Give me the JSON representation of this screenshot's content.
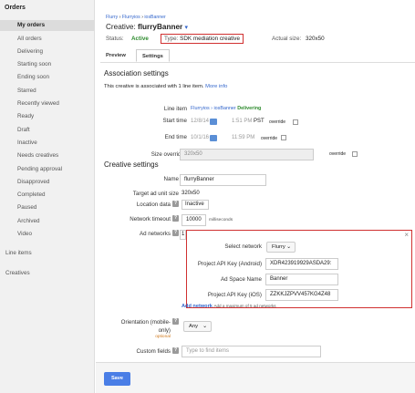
{
  "sidebar": {
    "heading": "Orders",
    "items": [
      {
        "label": "My orders",
        "active": true
      },
      {
        "label": "All orders"
      },
      {
        "label": "Delivering"
      },
      {
        "label": "Starting soon"
      },
      {
        "label": "Ending soon"
      },
      {
        "label": "Starred"
      },
      {
        "label": "Recently viewed"
      },
      {
        "label": "Ready"
      },
      {
        "label": "Draft"
      },
      {
        "label": "Inactive"
      },
      {
        "label": "Needs creatives"
      },
      {
        "label": "Pending approval"
      },
      {
        "label": "Disapproved"
      },
      {
        "label": "Completed"
      },
      {
        "label": "Paused"
      },
      {
        "label": "Archived"
      },
      {
        "label": "Video"
      }
    ],
    "line_items": "Line items",
    "creatives": "Creatives"
  },
  "breadcrumb": {
    "a": "Flurry",
    "b": "Flurryios",
    "c": "iosBanner",
    "sep": " › "
  },
  "title": {
    "prefix": "Creative: ",
    "name": "flurryBanner",
    "caret": "▾"
  },
  "status": {
    "label": "Status:",
    "value": "Active",
    "type_label": "Type:",
    "type_value": "SDK mediation creative",
    "size_label": "Actual size:",
    "size_value": "320x50"
  },
  "tabs": {
    "preview": "Preview",
    "settings": "Settings"
  },
  "association": {
    "heading": "Association settings",
    "text": "This creative is associated with 1 line item.",
    "more_info": "More info",
    "line_item_label": "Line item",
    "line_item_value": "Flurryios › iosBanner",
    "line_item_status": "Delivering",
    "start_label": "Start time",
    "start_date": "12/8/14",
    "start_time": "1:51 PM",
    "start_tz": "PST",
    "overrride": "override",
    "end_label": "End time",
    "end_date": "10/1/16",
    "end_time": "11:59 PM",
    "size_override_label": "Size overrides",
    "size_override_value": "320x50"
  },
  "creative": {
    "heading": "Creative settings",
    "name_label": "Name",
    "name_value": "flurryBanner",
    "target_label": "Target ad unit size",
    "target_value": "320x50",
    "location_label": "Location data",
    "location_value": "Inactive",
    "timeout_label": "Network timeout",
    "timeout_value": "10000",
    "timeout_unit": "milliseconds",
    "ad_networks_label": "Ad networks",
    "ad_networks_count": "1",
    "popup": {
      "select_label": "Select network",
      "select_value": "Flurry",
      "api_android_label": "Project API Key (Android)",
      "api_android_value": "XDR423919929ASDA29:",
      "space_label": "Ad Space Name",
      "space_value": "Banner",
      "api_ios_label": "Project API Key (iOS)",
      "api_ios_value": "ZZKKJZPVV457KG4Z48",
      "close": "×"
    },
    "add_network": "Add network",
    "add_network_note": "Add a maximum of 5 ad networks",
    "orientation_label": "Orientation (mobile-",
    "orientation_label2": "only)",
    "orientation_optional": "optional",
    "orientation_value": "Any",
    "custom_label": "Custom fields",
    "custom_placeholder": "Type to find items"
  },
  "save": "Save",
  "hint_glyph": "?"
}
